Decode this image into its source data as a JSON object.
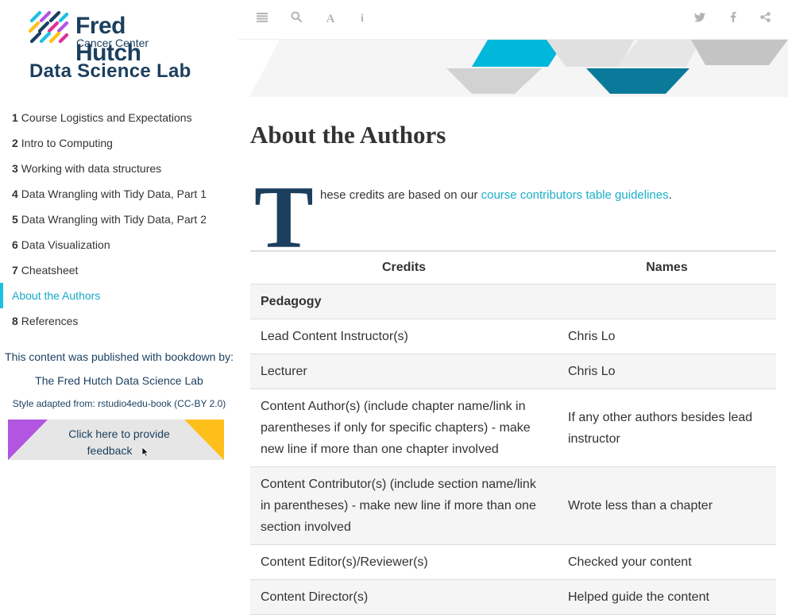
{
  "logo": {
    "line1": "Fred Hutch",
    "line2": "Cancer Center",
    "line3": "Data Science Lab"
  },
  "toc": [
    {
      "num": "1",
      "label": "Course Logistics and Expectations"
    },
    {
      "num": "2",
      "label": "Intro to Computing"
    },
    {
      "num": "3",
      "label": "Working with data structures"
    },
    {
      "num": "4",
      "label": "Data Wrangling with Tidy Data, Part 1"
    },
    {
      "num": "5",
      "label": "Data Wrangling with Tidy Data, Part 2"
    },
    {
      "num": "6",
      "label": "Data Visualization"
    },
    {
      "num": "7",
      "label": "Cheatsheet"
    },
    {
      "num": "",
      "label": "About the Authors",
      "active": true
    },
    {
      "num": "8",
      "label": "References"
    }
  ],
  "sidebar": {
    "published": "This content was published with bookdown by:",
    "lab_link": "The Fred Hutch Data Science Lab",
    "style_note": "Style adapted from: rstudio4edu-book (CC-BY 2.0)",
    "feedback_line1": "Click here to provide",
    "feedback_line2": "feedback"
  },
  "toolbar": {
    "icons": [
      "menu-icon",
      "search-icon",
      "font-icon",
      "info-icon",
      "twitter-icon",
      "facebook-icon",
      "share-icon"
    ]
  },
  "main": {
    "title": "About the Authors",
    "dropcap": "T",
    "intro_text": "hese credits are based on our ",
    "intro_link": "course contributors table guidelines",
    "intro_end": "."
  },
  "table": {
    "headers": [
      "Credits",
      "Names"
    ],
    "rows": [
      [
        "Pedagogy",
        ""
      ],
      [
        "Lead Content Instructor(s)",
        "Chris Lo"
      ],
      [
        "Lecturer",
        "Chris Lo"
      ],
      [
        "Content Author(s) (include chapter name/link in parentheses if only for specific chapters) - make new line if more than one chapter involved",
        "If any other authors besides lead instructor"
      ],
      [
        "Content Contributor(s) (include section name/link in parentheses) - make new line if more than one section involved",
        "Wrote less than a chapter"
      ],
      [
        "Content Editor(s)/Reviewer(s)",
        "Checked your content"
      ],
      [
        "Content Director(s)",
        "Helped guide the content"
      ]
    ]
  },
  "colors": {
    "navy": "#1c3f5e",
    "accent": "#1ec0e0",
    "link": "#1ab0c9",
    "feedback_purple": "#b255e0",
    "feedback_yellow": "#ffbf1a"
  }
}
